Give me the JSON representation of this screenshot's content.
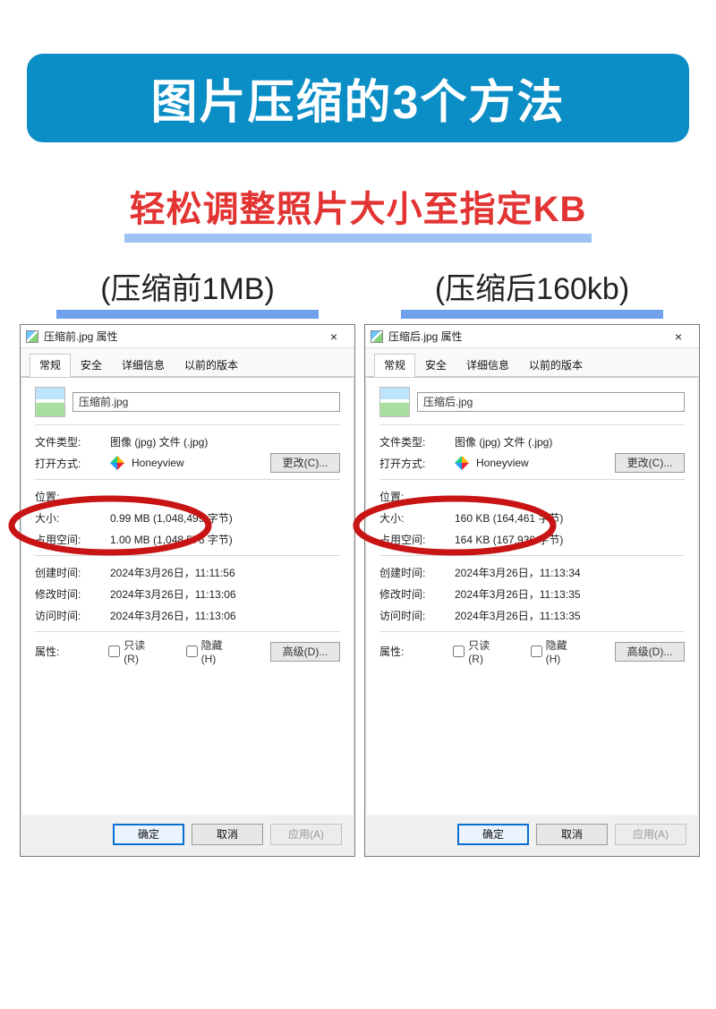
{
  "banner": {
    "text": "图片压缩的3个方法"
  },
  "subtitle": {
    "text": "轻松调整照片大小至指定KB"
  },
  "columns": [
    {
      "heading": "(压缩前1MB)"
    },
    {
      "heading": "(压缩后160kb)"
    }
  ],
  "dialogs": [
    {
      "title": "压缩前.jpg 属性",
      "close": "×",
      "tabs": [
        "常规",
        "安全",
        "详细信息",
        "以前的版本"
      ],
      "filename": "压缩前.jpg",
      "fields": {
        "type_label": "文件类型:",
        "type_value": "图像 (jpg) 文件 (.jpg)",
        "open_label": "打开方式:",
        "open_value": "Honeyview",
        "change_btn": "更改(C)...",
        "location_label": "位置:",
        "location_value": "",
        "size_label": "大小:",
        "size_value": "0.99 MB (1,048,499 字节)",
        "disk_label": "占用空间:",
        "disk_value": "1.00 MB (1,048,576 字节)",
        "created_label": "创建时间:",
        "created_value": "2024年3月26日，11:11:56",
        "modified_label": "修改时间:",
        "modified_value": "2024年3月26日，11:13:06",
        "accessed_label": "访问时间:",
        "accessed_value": "2024年3月26日，11:13:06",
        "attrs_label": "属性:",
        "readonly": "只读(R)",
        "hidden": "隐藏(H)",
        "advanced_btn": "高级(D)..."
      },
      "footer": {
        "ok": "确定",
        "cancel": "取消",
        "apply": "应用(A)"
      }
    },
    {
      "title": "压缩后.jpg 属性",
      "close": "×",
      "tabs": [
        "常规",
        "安全",
        "详细信息",
        "以前的版本"
      ],
      "filename": "压缩后.jpg",
      "fields": {
        "type_label": "文件类型:",
        "type_value": "图像 (jpg) 文件 (.jpg)",
        "open_label": "打开方式:",
        "open_value": "Honeyview",
        "change_btn": "更改(C)...",
        "location_label": "位置:",
        "location_value": "",
        "size_label": "大小:",
        "size_value": "160 KB (164,461 字节)",
        "disk_label": "占用空间:",
        "disk_value": "164 KB (167,936 字节)",
        "created_label": "创建时间:",
        "created_value": "2024年3月26日，11:13:34",
        "modified_label": "修改时间:",
        "modified_value": "2024年3月26日，11:13:35",
        "accessed_label": "访问时间:",
        "accessed_value": "2024年3月26日，11:13:35",
        "attrs_label": "属性:",
        "readonly": "只读(R)",
        "hidden": "隐藏(H)",
        "advanced_btn": "高级(D)..."
      },
      "footer": {
        "ok": "确定",
        "cancel": "取消",
        "apply": "应用(A)"
      }
    }
  ]
}
